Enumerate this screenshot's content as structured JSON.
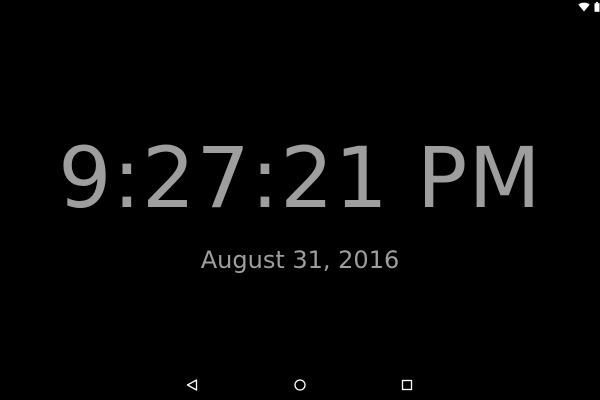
{
  "status_bar": {
    "icons": [
      "wifi-icon",
      "battery-icon"
    ],
    "icon_color": "#ffffff"
  },
  "clock": {
    "time": "9:27:21 PM",
    "date": "August 31, 2016",
    "text_color": "#9e9e9e"
  },
  "nav_bar": {
    "icons": [
      "back-icon",
      "home-icon",
      "recents-icon"
    ],
    "icon_color": "#ffffff"
  },
  "background_color": "#000000"
}
